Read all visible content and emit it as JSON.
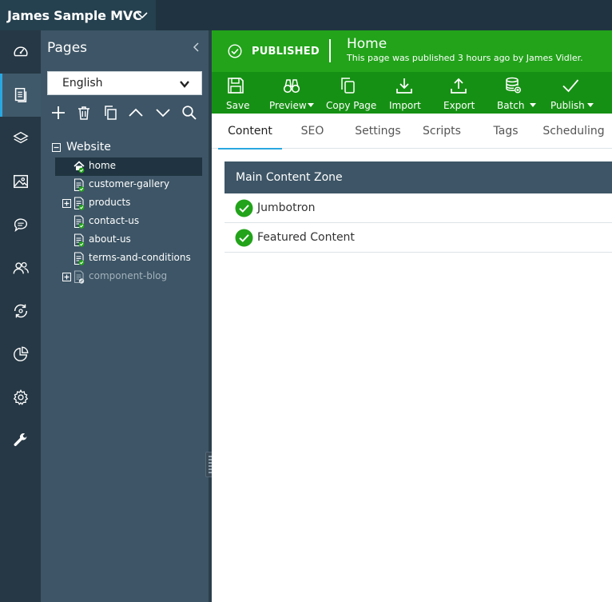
{
  "header": {
    "site_name": "James Sample MVC"
  },
  "rail": {
    "items": [
      {
        "name": "dashboard",
        "active": false
      },
      {
        "name": "pages",
        "active": true
      },
      {
        "name": "layers",
        "active": false
      },
      {
        "name": "media",
        "active": false
      },
      {
        "name": "comments",
        "active": false
      },
      {
        "name": "users",
        "active": false
      },
      {
        "name": "workflow",
        "active": false
      },
      {
        "name": "analytics",
        "active": false
      },
      {
        "name": "settings",
        "active": false
      },
      {
        "name": "tools",
        "active": false
      }
    ]
  },
  "pages_panel": {
    "title": "Pages",
    "language": "English",
    "tools": [
      "add",
      "delete",
      "copy",
      "move-up",
      "move-down",
      "search"
    ],
    "tree": {
      "root": "Website",
      "items": [
        {
          "label": "home",
          "selected": true,
          "expandable": false,
          "status": "published",
          "icon": "home-icon"
        },
        {
          "label": "customer-gallery",
          "selected": false,
          "expandable": false,
          "status": "published",
          "icon": "page-icon"
        },
        {
          "label": "products",
          "selected": false,
          "expandable": true,
          "status": "published",
          "icon": "page-icon"
        },
        {
          "label": "contact-us",
          "selected": false,
          "expandable": false,
          "status": "published",
          "icon": "page-icon"
        },
        {
          "label": "about-us",
          "selected": false,
          "expandable": false,
          "status": "published",
          "icon": "page-icon"
        },
        {
          "label": "terms-and-conditions",
          "selected": false,
          "expandable": false,
          "status": "published",
          "icon": "page-icon"
        },
        {
          "label": "component-blog",
          "selected": false,
          "expandable": true,
          "status": "unpublished",
          "icon": "page-icon"
        }
      ]
    }
  },
  "status": {
    "state": "PUBLISHED",
    "page_name": "Home",
    "message": "This page was published 3 hours ago by James Vidler."
  },
  "toolbar": {
    "save": "Save",
    "preview": "Preview",
    "copy_page": "Copy Page",
    "import": "Import",
    "export": "Export",
    "batch": "Batch",
    "publish": "Publish"
  },
  "tabs": [
    {
      "label": "Content",
      "active": true
    },
    {
      "label": "SEO",
      "active": false
    },
    {
      "label": "Settings",
      "active": false
    },
    {
      "label": "Scripts",
      "active": false
    },
    {
      "label": "Tags",
      "active": false
    },
    {
      "label": "Scheduling",
      "active": false
    }
  ],
  "zone": {
    "title": "Main Content Zone",
    "items": [
      {
        "label": "Jumbotron",
        "status": "ok"
      },
      {
        "label": "Featured Content",
        "status": "ok"
      }
    ]
  },
  "colors": {
    "header_bg": "#1f3440",
    "rail_bg": "#263845",
    "panel_bg": "#3d5566",
    "published_green": "#22a31a",
    "toolbar_green": "#169014",
    "accent_blue": "#2aa7e0"
  }
}
